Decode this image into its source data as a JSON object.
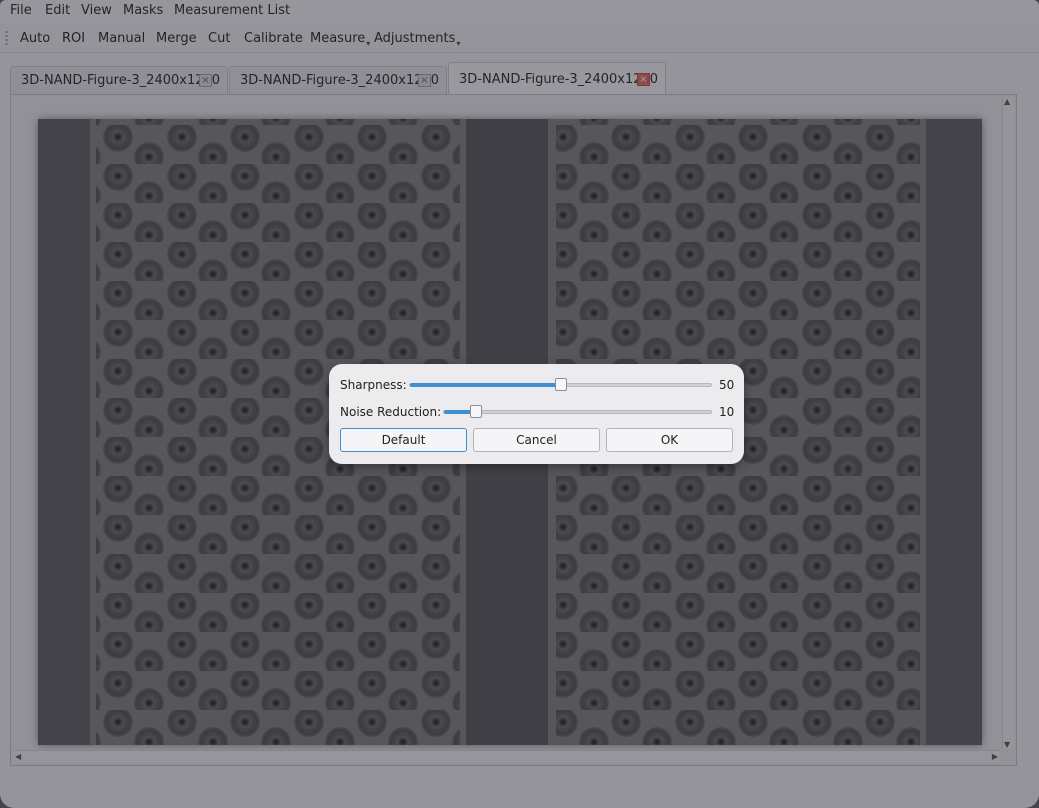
{
  "menubar": {
    "items": [
      "File",
      "Edit",
      "View",
      "Masks",
      "Measurement List"
    ]
  },
  "toolbar": {
    "items": [
      {
        "label": "Auto",
        "dropdown": false
      },
      {
        "label": "ROI",
        "dropdown": false
      },
      {
        "label": "Manual",
        "dropdown": false
      },
      {
        "label": "Merge",
        "dropdown": false
      },
      {
        "label": "Cut",
        "dropdown": false
      },
      {
        "label": "Calibrate",
        "dropdown": false
      },
      {
        "label": "Measure",
        "dropdown": true
      },
      {
        "label": "Adjustments",
        "dropdown": true
      }
    ]
  },
  "tabs": [
    {
      "label": "3D-NAND-Figure-3_2400x1200",
      "active": false
    },
    {
      "label": "3D-NAND-Figure-3_2400x1200",
      "active": false
    },
    {
      "label": "3D-NAND-Figure-3_2400x1200",
      "active": true
    }
  ],
  "dialog": {
    "sharpness": {
      "label": "Sharpness:",
      "value": "50",
      "fraction": 0.5
    },
    "noise_reduction": {
      "label": "Noise Reduction:",
      "value": "10",
      "fraction": 0.1
    },
    "buttons": {
      "default": "Default",
      "cancel": "Cancel",
      "ok": "OK"
    }
  },
  "colors": {
    "accent": "#3d8ed3",
    "active_tab_close": "#e46a5e"
  }
}
